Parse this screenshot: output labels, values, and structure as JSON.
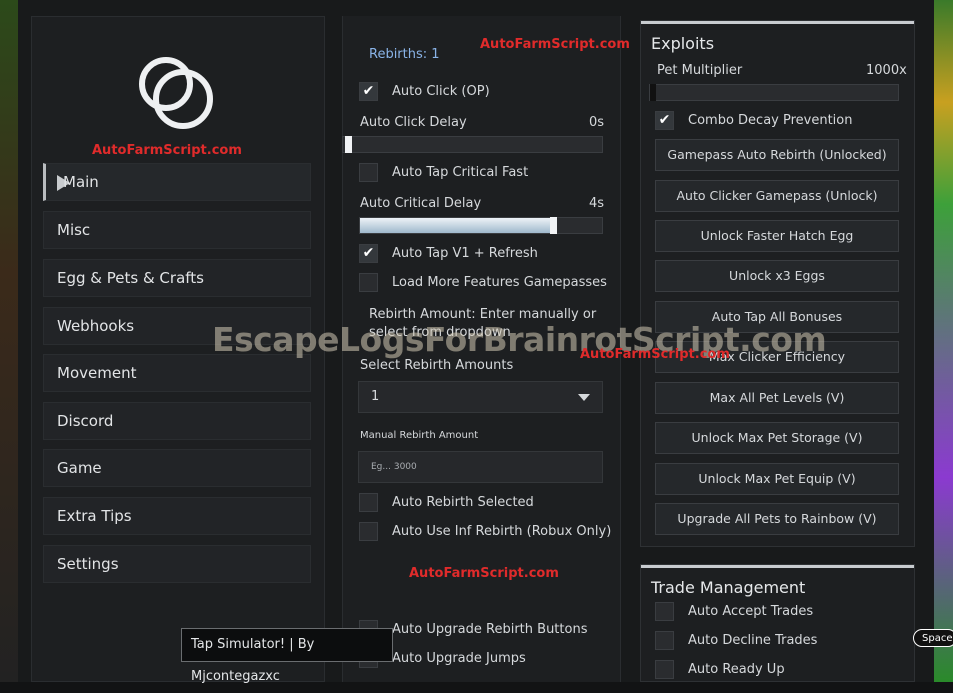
{
  "watermarks": {
    "brand_1": "AutoFarmScript.com",
    "brand_2": "AutoFarmScript.com",
    "brand_3": "AutoFarmScript.com",
    "brand_4": "AutoFarmScript.com",
    "overlay": "EscapeLogsForBrainrotScript.com"
  },
  "sidebar": {
    "items": [
      {
        "label": "Main"
      },
      {
        "label": "Misc"
      },
      {
        "label": "Egg & Pets & Crafts"
      },
      {
        "label": "Webhooks"
      },
      {
        "label": "Movement"
      },
      {
        "label": "Discord"
      },
      {
        "label": "Game"
      },
      {
        "label": "Extra Tips"
      },
      {
        "label": "Settings"
      }
    ]
  },
  "main": {
    "rebirths_label": "Rebirths: 1",
    "auto_click": {
      "label": "Auto Click (OP)",
      "checked": true
    },
    "auto_click_delay": {
      "label": "Auto Click Delay",
      "value": "0s",
      "fraction": 0.0
    },
    "auto_tap_critical": {
      "label": "Auto Tap Critical Fast",
      "checked": false
    },
    "auto_critical_delay": {
      "label": "Auto Critical Delay",
      "value": "4s",
      "fraction": 0.8
    },
    "auto_tap_v1": {
      "label": "Auto Tap V1 + Refresh",
      "checked": true
    },
    "load_more": {
      "label": "Load More Features Gamepasses",
      "checked": false
    },
    "rebirth_amount_note_1": "Rebirth Amount: Enter manually or",
    "rebirth_amount_note_2": "select from dropdown",
    "select_rebirth_label": "Select Rebirth Amounts",
    "select_rebirth_value": "1",
    "manual_rebirth_label": "Manual Rebirth Amount",
    "manual_rebirth_placeholder": "Eg... 3000",
    "auto_rebirth_selected": {
      "label": "Auto Rebirth Selected",
      "checked": false
    },
    "auto_use_inf_rebirth": {
      "label": "Auto Use Inf Rebirth (Robux Only)",
      "checked": false
    },
    "auto_upgrade_rebirth": {
      "label": "Auto Upgrade Rebirth Buttons",
      "checked": false
    },
    "auto_upgrade_jumps": {
      "label": "Auto Upgrade Jumps",
      "checked": false
    }
  },
  "exploits": {
    "title": "Exploits",
    "pet_multiplier": {
      "label": "Pet Multiplier",
      "value": "1000x",
      "fraction": 0.0
    },
    "combo_decay": {
      "label": "Combo Decay Prevention",
      "checked": true
    },
    "buttons": [
      "Gamepass Auto Rebirth (Unlocked)",
      "Auto Clicker Gamepass (Unlock)",
      "Unlock Faster Hatch Egg",
      "Unlock x3 Eggs",
      "Auto Tap All Bonuses",
      "Max Clicker Efficiency",
      "Max All Pet Levels (V)",
      "Unlock Max Pet Storage (V)",
      "Unlock Max Pet Equip (V)",
      "Upgrade All Pets to Rainbow (V)"
    ]
  },
  "trade": {
    "title": "Trade Management",
    "auto_accept": {
      "label": "Auto Accept Trades",
      "checked": false
    },
    "auto_decline": {
      "label": "Auto Decline Trades",
      "checked": false
    },
    "auto_ready": {
      "label": "Auto Ready Up",
      "checked": false
    }
  },
  "tooltip": "Tap Simulator! | By Mjcontegazxc",
  "space_key": "Space"
}
